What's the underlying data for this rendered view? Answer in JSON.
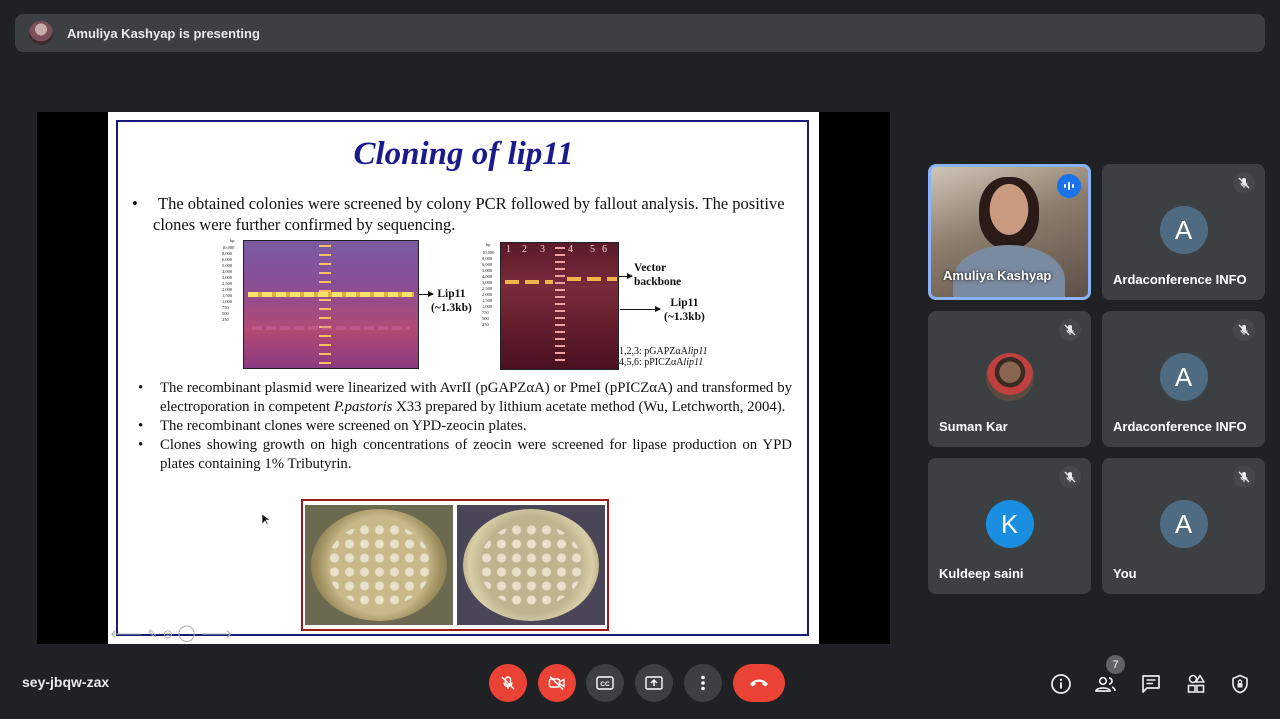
{
  "banner": {
    "presenter_text": "Amuliya Kashyap is presenting"
  },
  "slide": {
    "title": "Cloning of lip11",
    "intro_bullet": "•",
    "intro": "The obtained colonies were screened by colony PCR followed by fallout analysis. The positive clones were further confirmed by sequencing.",
    "gel1": {
      "label_bp": "bp",
      "ladder_labels": [
        "10,000",
        "8,000",
        "6,000",
        "5,000",
        "4,000",
        "3,000",
        "2,500",
        "2,000",
        "1,500",
        "1,000",
        "750",
        "500",
        "250"
      ],
      "band_label": "Lip11",
      "band_size": "(~1.3kb)"
    },
    "gel2": {
      "label_bp": "bp",
      "lanes": [
        "1",
        "2",
        "3",
        "4",
        "5",
        "6"
      ],
      "ladder_labels": [
        "10,000",
        "8,000",
        "6,000",
        "5,000",
        "4,000",
        "3,000",
        "2,500",
        "2,000",
        "1,500",
        "1,000",
        "750",
        "500",
        "250"
      ],
      "vector_label_1": "Vector",
      "vector_label_2": "backbone",
      "band_label": "Lip11",
      "band_size": "(~1.3kb)",
      "legend_1_prefix": "1,2,3: pGAPZαA",
      "legend_1_italic": "lip11",
      "legend_2_prefix": "4,5,6: pPICZαA",
      "legend_2_italic": "lip11"
    },
    "bullets": [
      {
        "pre": "The recombinant plasmid were linearized with AvrII (pGAPZαA) or PmeI (pPICZαA) and transformed by electroporation in competent ",
        "italic": "P.pastoris",
        "post": " X33 prepared by lithium acetate method (Wu, Letchworth, 2004)."
      },
      {
        "text": "The recombinant clones were screened on YPD-zeocin plates."
      },
      {
        "text": "Clones showing growth on high concentrations of zeocin were screened for lipase production on YPD plates containing 1% Tributyrin."
      }
    ],
    "toolbar_glyphs": "🡐 ✎ ⊜ ◯ 🡒"
  },
  "participants": [
    {
      "name": "Amuliya Kashyap",
      "type": "video",
      "speaking": true
    },
    {
      "name": "Ardaconference INFO",
      "type": "letter",
      "letter": "A",
      "muted": true
    },
    {
      "name": "Suman Kar",
      "type": "photo",
      "muted": true
    },
    {
      "name": "Ardaconference INFO",
      "type": "letter",
      "letter": "A",
      "muted": true
    },
    {
      "name": "Kuldeep saini",
      "type": "letter",
      "letter": "K",
      "color": "#1a8ee0",
      "muted": true
    },
    {
      "name": "You",
      "type": "letter",
      "letter": "A",
      "muted": true
    }
  ],
  "controls": {
    "meeting_code": "sey-jbqw-zax",
    "center_icons": [
      "mic-off-icon",
      "camera-off-icon",
      "captions-icon",
      "present-icon",
      "more-icon",
      "hang-up-icon"
    ],
    "right_icons": [
      "info-icon",
      "people-icon",
      "chat-icon",
      "activities-icon",
      "host-controls-icon"
    ],
    "people_count": "7"
  },
  "colors": {
    "accent": "#8ab4f8",
    "danger": "#ea4335",
    "surface": "#3c4043",
    "background": "#202124",
    "slide_title": "#1a1a8c"
  }
}
